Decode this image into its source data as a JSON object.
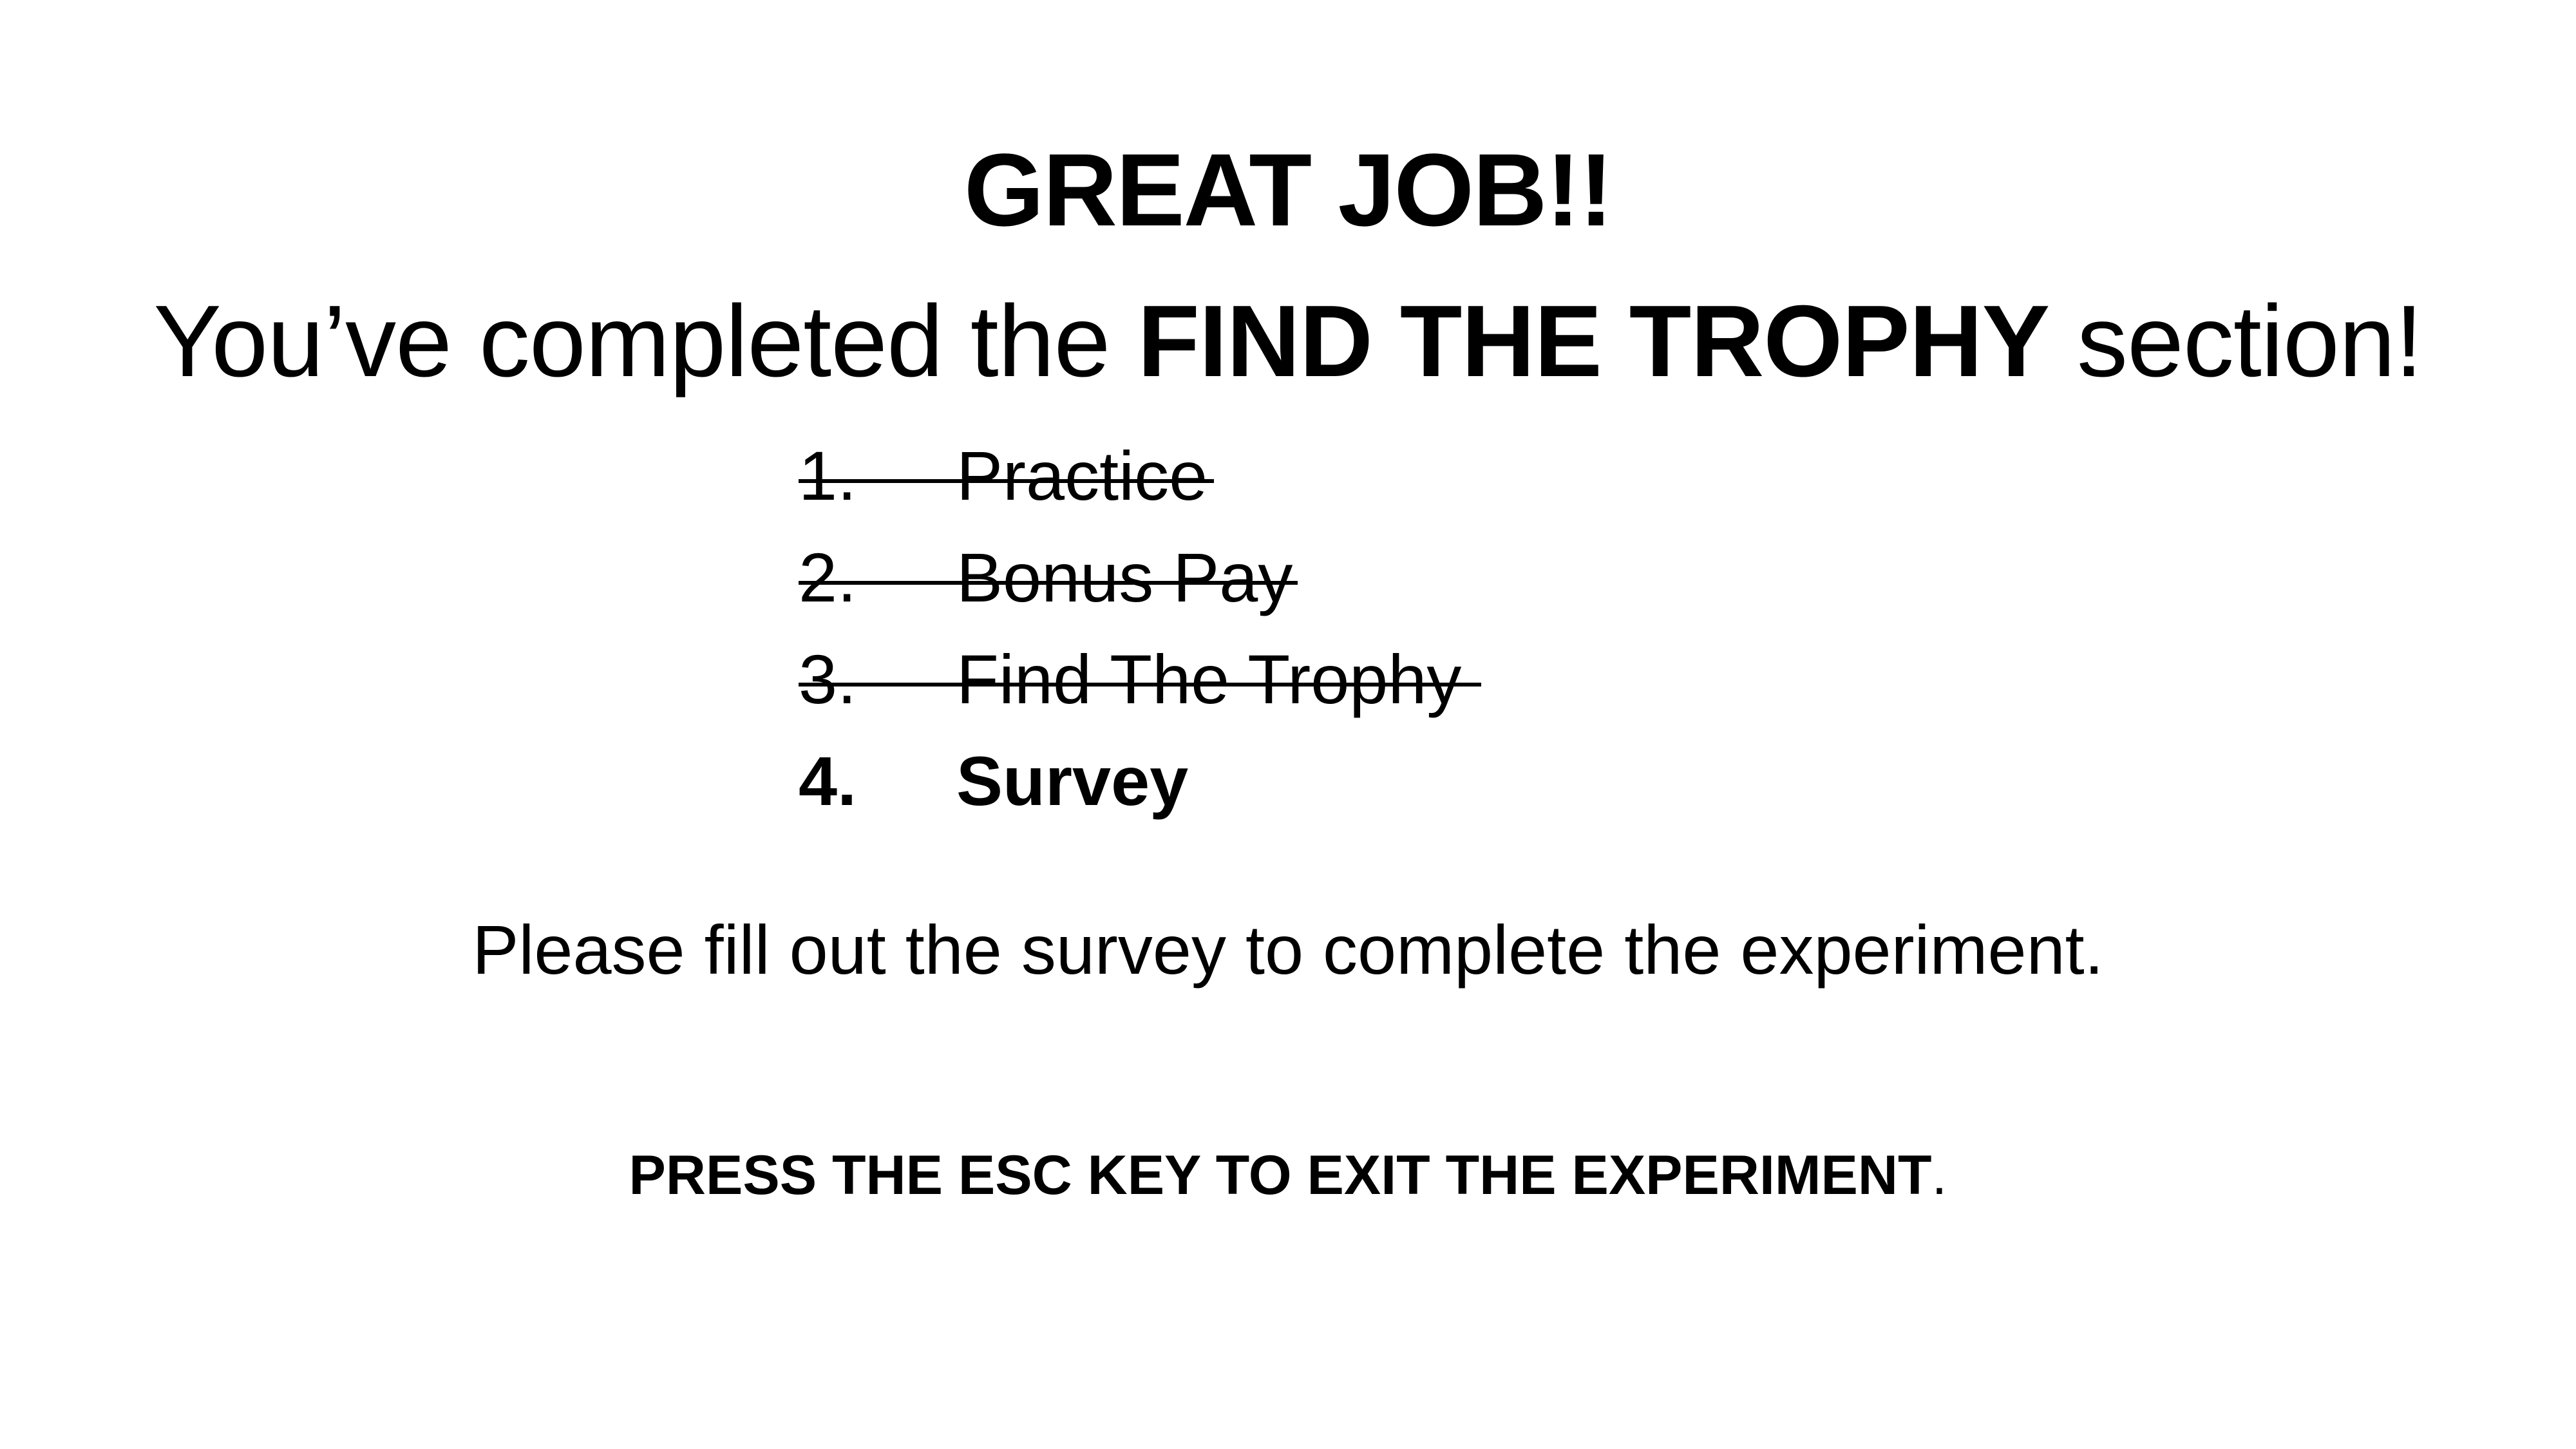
{
  "headline": "GREAT JOB!!",
  "subhead": {
    "prefix": "You’ve completed the ",
    "bold": "FIND THE TROPHY",
    "suffix": " section!"
  },
  "steps": [
    {
      "number": "1.",
      "label": "Practice",
      "status": "done"
    },
    {
      "number": "2.",
      "label": "Bonus Pay",
      "status": "done"
    },
    {
      "number": "3.",
      "label": "Find The Trophy",
      "status": "done"
    },
    {
      "number": "4.",
      "label": "Survey",
      "status": "current"
    }
  ],
  "instructions": "Please fill out the survey to complete the experiment.",
  "exit": {
    "bold": "PRESS THE ESC KEY TO EXIT THE EXPERIMENT",
    "suffix": "."
  }
}
